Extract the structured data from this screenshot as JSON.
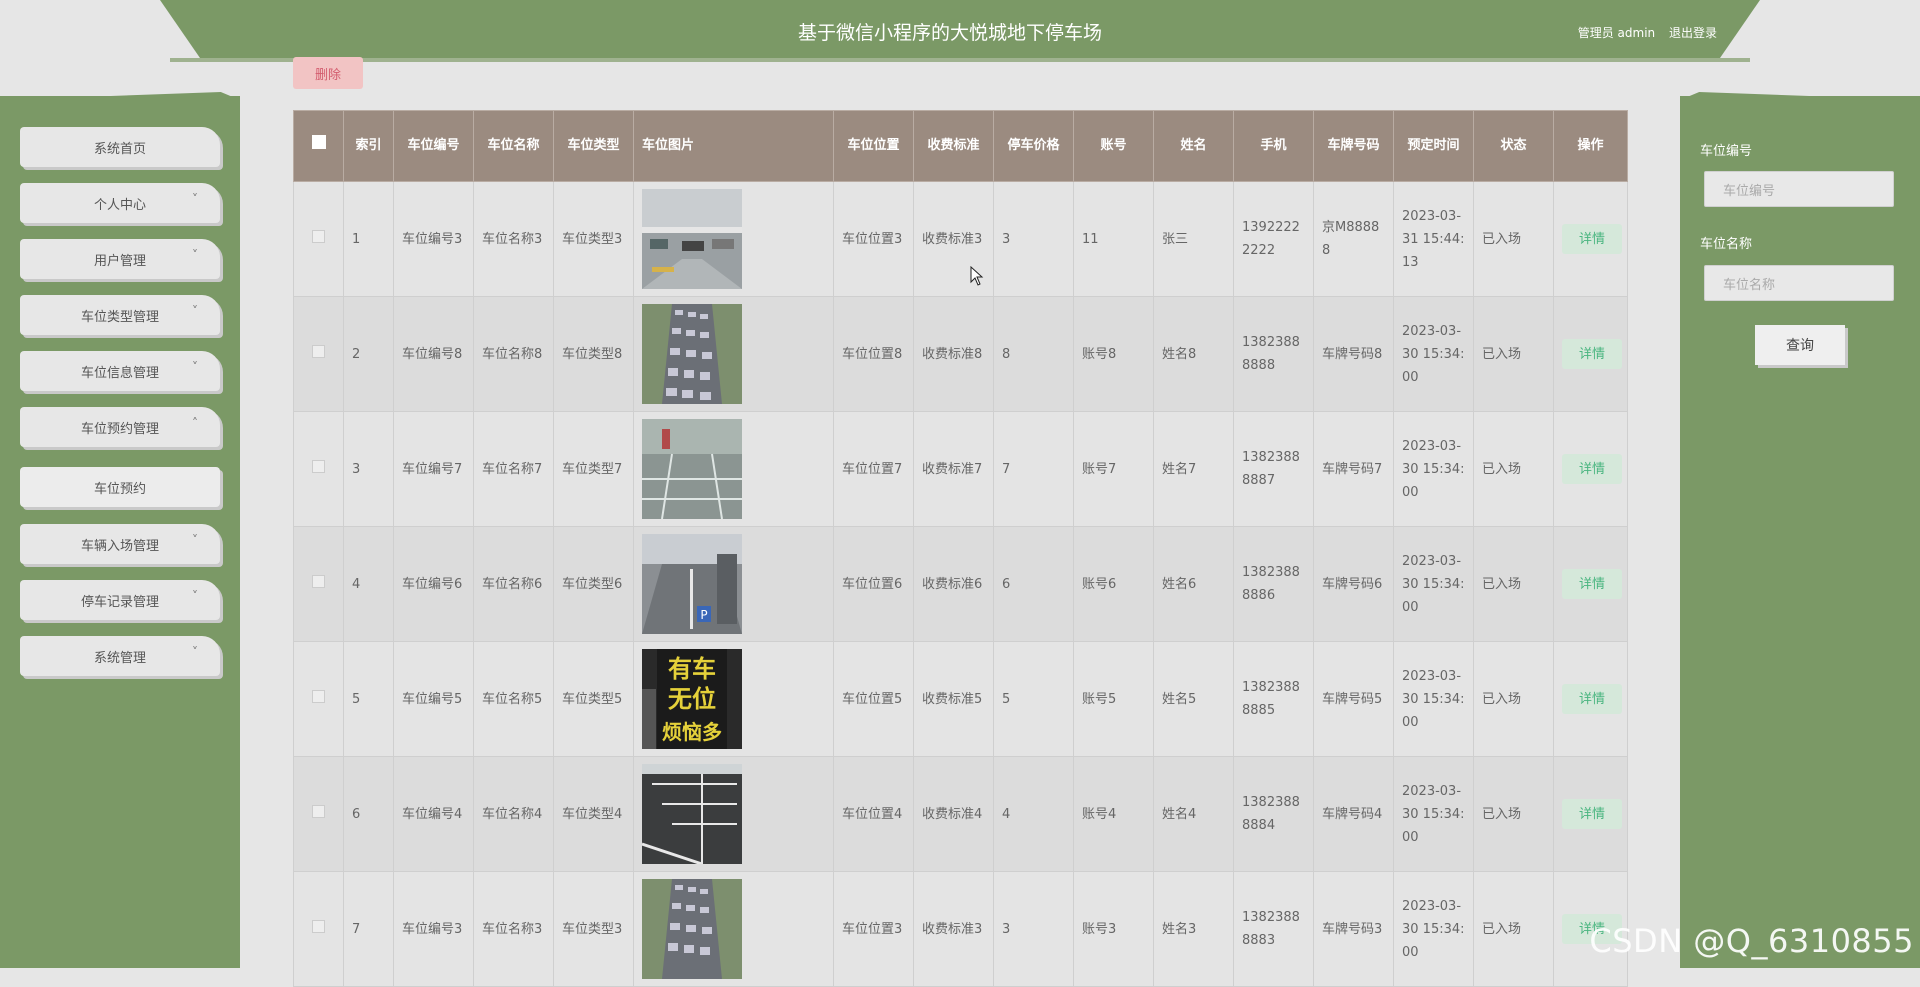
{
  "header": {
    "title": "基于微信小程序的大悦城地下停车场",
    "user": "管理员 admin",
    "logout": "退出登录"
  },
  "sidebar": {
    "items": [
      {
        "label": "系统首页",
        "chevron": ""
      },
      {
        "label": "个人中心",
        "chevron": "˅"
      },
      {
        "label": "用户管理",
        "chevron": "˅"
      },
      {
        "label": "车位类型管理",
        "chevron": "˅"
      },
      {
        "label": "车位信息管理",
        "chevron": "˅"
      },
      {
        "label": "车位预约管理",
        "chevron": "˄"
      },
      {
        "label": "车位预约",
        "chevron": ""
      },
      {
        "label": "车辆入场管理",
        "chevron": "˅"
      },
      {
        "label": "停车记录管理",
        "chevron": "˅"
      },
      {
        "label": "系统管理",
        "chevron": "˅"
      }
    ]
  },
  "toolbar": {
    "delete": "删除"
  },
  "table": {
    "headers": [
      "",
      "索引",
      "车位编号",
      "车位名称",
      "车位类型",
      "车位图片",
      "车位位置",
      "收费标准",
      "停车价格",
      "账号",
      "姓名",
      "手机",
      "车牌号码",
      "预定时间",
      "状态",
      "操作"
    ],
    "detail_label": "详情",
    "rows": [
      {
        "idx": "1",
        "code": "车位编号3",
        "name": "车位名称3",
        "type": "车位类型3",
        "loc": "车位位置3",
        "fee": "收费标准3",
        "price": "3",
        "account": "11",
        "person": "张三",
        "phone": "13922222222",
        "plate": "京M88888",
        "time": "2023-03-31 15:44:13",
        "status": "已入场"
      },
      {
        "idx": "2",
        "code": "车位编号8",
        "name": "车位名称8",
        "type": "车位类型8",
        "loc": "车位位置8",
        "fee": "收费标准8",
        "price": "8",
        "account": "账号8",
        "person": "姓名8",
        "phone": "13823888888",
        "plate": "车牌号码8",
        "time": "2023-03-30 15:34:00",
        "status": "已入场"
      },
      {
        "idx": "3",
        "code": "车位编号7",
        "name": "车位名称7",
        "type": "车位类型7",
        "loc": "车位位置7",
        "fee": "收费标准7",
        "price": "7",
        "account": "账号7",
        "person": "姓名7",
        "phone": "13823888887",
        "plate": "车牌号码7",
        "time": "2023-03-30 15:34:00",
        "status": "已入场"
      },
      {
        "idx": "4",
        "code": "车位编号6",
        "name": "车位名称6",
        "type": "车位类型6",
        "loc": "车位位置6",
        "fee": "收费标准6",
        "price": "6",
        "account": "账号6",
        "person": "姓名6",
        "phone": "13823888886",
        "plate": "车牌号码6",
        "time": "2023-03-30 15:34:00",
        "status": "已入场"
      },
      {
        "idx": "5",
        "code": "车位编号5",
        "name": "车位名称5",
        "type": "车位类型5",
        "loc": "车位位置5",
        "fee": "收费标准5",
        "price": "5",
        "account": "账号5",
        "person": "姓名5",
        "phone": "13823888885",
        "plate": "车牌号码5",
        "time": "2023-03-30 15:34:00",
        "status": "已入场"
      },
      {
        "idx": "6",
        "code": "车位编号4",
        "name": "车位名称4",
        "type": "车位类型4",
        "loc": "车位位置4",
        "fee": "收费标准4",
        "price": "4",
        "account": "账号4",
        "person": "姓名4",
        "phone": "13823888884",
        "plate": "车牌号码4",
        "time": "2023-03-30 15:34:00",
        "status": "已入场"
      },
      {
        "idx": "7",
        "code": "车位编号3",
        "name": "车位名称3",
        "type": "车位类型3",
        "loc": "车位位置3",
        "fee": "收费标准3",
        "price": "3",
        "account": "账号3",
        "person": "姓名3",
        "phone": "13823888883",
        "plate": "车牌号码3",
        "time": "2023-03-30 15:34:00",
        "status": "已入场"
      }
    ]
  },
  "search": {
    "code_label": "车位编号",
    "code_placeholder": "车位编号",
    "name_label": "车位名称",
    "name_placeholder": "车位名称",
    "query": "查询"
  },
  "watermark": "CSDN @Q_6310855"
}
